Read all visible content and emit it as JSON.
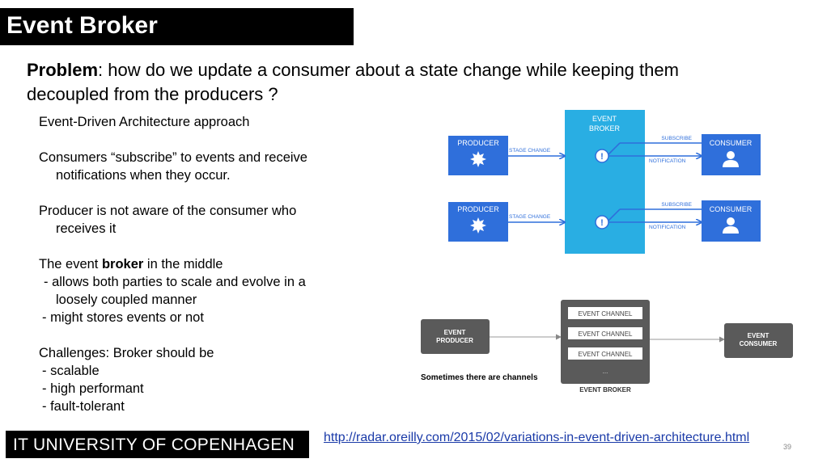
{
  "slide": {
    "title": "Event Broker",
    "problem_label": "Problem",
    "problem_text": ": how do we update a consumer about a state change while keeping them decoupled from the producers ?",
    "bullets": {
      "b1": "Event-Driven Architecture approach",
      "b2a": "Consumers “subscribe” to events and receive",
      "b2b": "notifications when they occur.",
      "b3a": "Producer is not aware of the consumer who",
      "b3b": "receives it",
      "b4_prefix": "The event ",
      "b4_bold": "broker",
      "b4_suffix": " in the middle",
      "b4_s1a": "- allows both parties to scale and evolve in a",
      "b4_s1b": "loosely coupled manner",
      "b4_s2": "- might stores events or not",
      "b5": "Challenges: Broker should be",
      "b5_s1": "- scalable",
      "b5_s2": "- high performant",
      "b5_s3": "- fault-tolerant"
    },
    "footer_brand": "IT UNIVERSITY OF COPENHAGEN",
    "link": "http://radar.oreilly.com/2015/02/variations-in-event-driven-architecture.html",
    "page_number": "39"
  },
  "diagram1": {
    "broker_label_1": "EVENT",
    "broker_label_2": "BROKER",
    "producer_label": "PRODUCER",
    "consumer_label": "CONSUMER",
    "stage_change": "STAGE CHANGE",
    "subscribe": "SUBSCRIBE",
    "notification": "NOTIFICATION",
    "colors": {
      "blue": "#2f6fdb",
      "broker": "#29aee3"
    }
  },
  "diagram2": {
    "producer_1": "EVENT",
    "producer_2": "PRODUCER",
    "consumer_1": "EVENT",
    "consumer_2": "CONSUMER",
    "channels": [
      "EVENT CHANNEL",
      "EVENT CHANNEL",
      "EVENT CHANNEL"
    ],
    "ellipsis": "...",
    "broker_label": "EVENT BROKER",
    "caption": "Sometimes there are channels",
    "colors": {
      "box": "#5a5a5a"
    }
  }
}
